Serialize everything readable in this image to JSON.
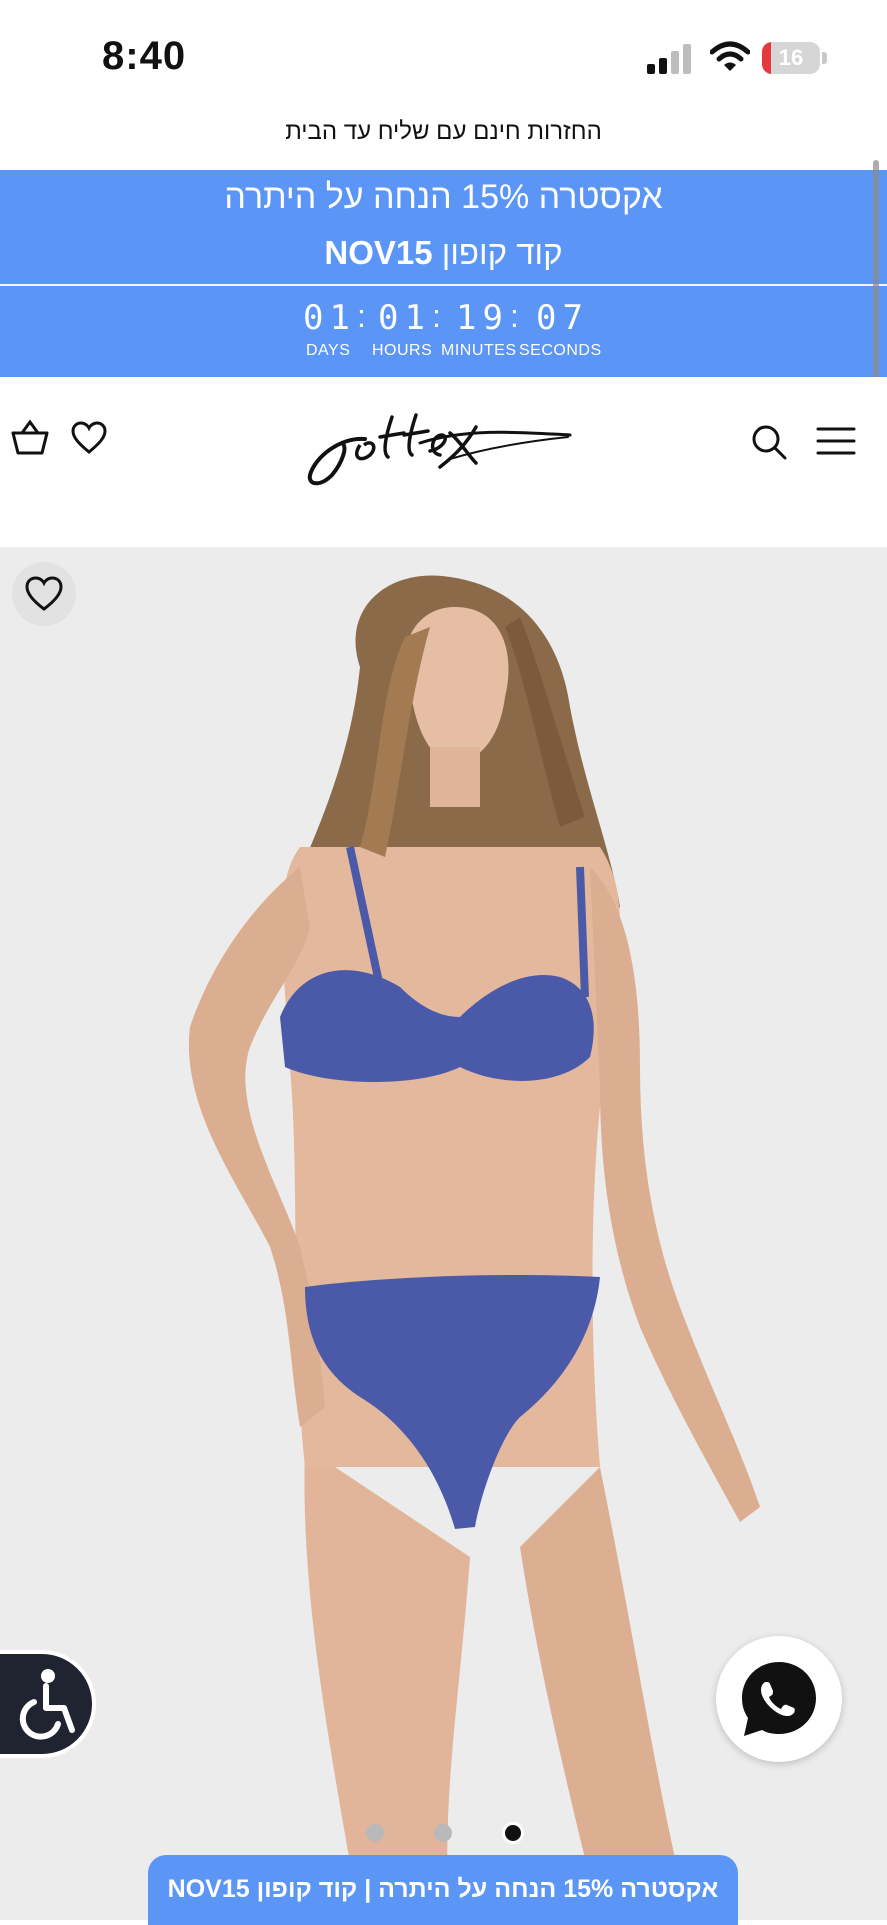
{
  "status_bar": {
    "time": "8:40",
    "battery_level": "16",
    "battery_fraction": 0.16,
    "icons": [
      "cellular-signal-icon",
      "wifi-icon",
      "battery-icon"
    ]
  },
  "shipping_notice": "החזרות חינם עם שליח עד הבית",
  "promo": {
    "line1": "אקסטרה 15% הנחה על היתרה",
    "coupon_prefix": "קוד קופון",
    "coupon_code": "NOV15",
    "countdown": {
      "days": "01",
      "hours": "01",
      "minutes": "19",
      "seconds": "07",
      "labels": {
        "days": "DAYS",
        "hours": "HOURS",
        "minutes": "MINUTES",
        "seconds": "SECONDS"
      }
    },
    "color": "#5b96f7"
  },
  "header": {
    "logo_text": "gottex",
    "icons": [
      "cart-icon",
      "heart-icon",
      "search-icon",
      "menu-icon"
    ]
  },
  "product": {
    "image_alt": "Model wearing blue bikini",
    "bikini_color": "#4a5aa8",
    "carousel": {
      "total": 3,
      "active_index": 2
    }
  },
  "floating": {
    "accessibility": "accessibility-icon",
    "whatsapp": "whatsapp-icon"
  },
  "bottom_banner": "אקסטרה 15% הנחה על היתרה | קוד קופון NOV15"
}
